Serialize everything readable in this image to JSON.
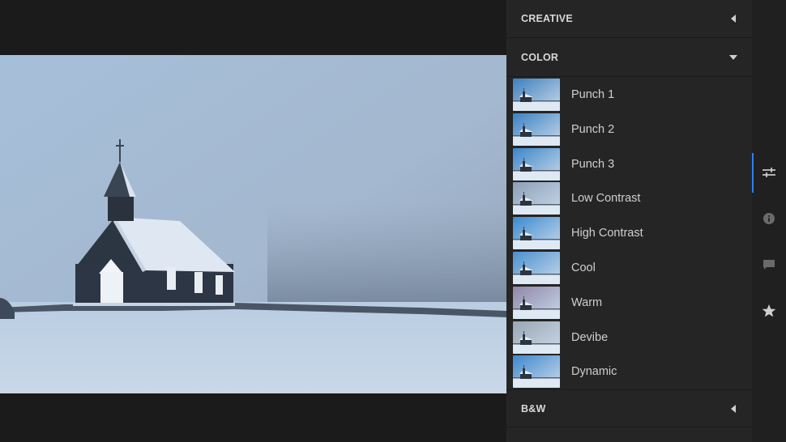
{
  "panel": {
    "sections": {
      "creative": {
        "title": "CREATIVE",
        "expanded": false
      },
      "color": {
        "title": "COLOR",
        "expanded": true
      },
      "bw": {
        "title": "B&W",
        "expanded": false
      }
    },
    "color_presets": [
      {
        "label": "Punch 1",
        "tint": "#3d7fbf"
      },
      {
        "label": "Punch 2",
        "tint": "#3b82c4"
      },
      {
        "label": "Punch 3",
        "tint": "#3c86c9"
      },
      {
        "label": "Low Contrast",
        "tint": "#8b9fb6"
      },
      {
        "label": "High Contrast",
        "tint": "#3a8ad0"
      },
      {
        "label": "Cool",
        "tint": "#4a90cf"
      },
      {
        "label": "Warm",
        "tint": "#8f86a8"
      },
      {
        "label": "Devibe",
        "tint": "#9aa6b2"
      },
      {
        "label": "Dynamic",
        "tint": "#3f88cf"
      }
    ]
  },
  "rail": {
    "icons": [
      "sliders-icon",
      "info-icon",
      "comment-icon",
      "star-icon"
    ],
    "active": "sliders-icon",
    "accent": "#2d7ff0"
  }
}
